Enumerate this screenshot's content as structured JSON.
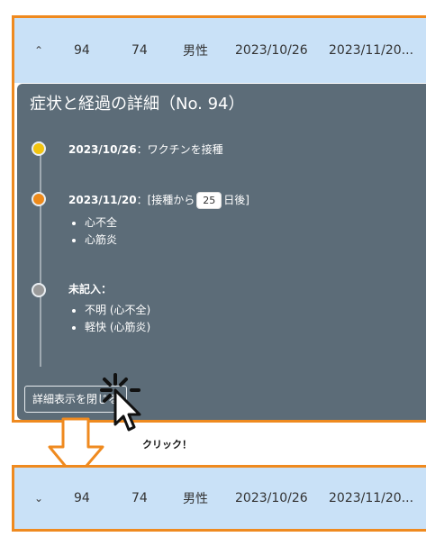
{
  "colors": {
    "frame": "#ef8a1f",
    "row_bg": "#c9e1f7",
    "panel_bg": "#5c6c78",
    "dot_first": "#f2c40f",
    "dot_second": "#ee8a1a",
    "dot_unknown": "#9a9a9a"
  },
  "row": {
    "id": "94",
    "age": "74",
    "sex": "男性",
    "date1": "2023/10/26",
    "date2": "2023/11/20..."
  },
  "top_row": {
    "chevron_icon": "chevron-up-icon",
    "chevron": "⌃"
  },
  "bottom_row": {
    "chevron_icon": "chevron-down-icon",
    "chevron": "⌄"
  },
  "detail": {
    "title": "症状と経過の詳細（No. 94）",
    "entries": [
      {
        "date": "2023/10/26",
        "sep": "：",
        "text": "ワクチンを接種"
      },
      {
        "date": "2023/11/20",
        "sep": "：",
        "prefix": "[接種から",
        "days": "25",
        "suffix": "日後]",
        "items": [
          "心不全",
          "心筋炎"
        ]
      },
      {
        "date": "未記入",
        "sep": "：",
        "items": [
          "不明 (心不全)",
          "軽快 (心筋炎)"
        ]
      }
    ],
    "close_button": "詳細表示を閉じる"
  },
  "annotation": {
    "click_label": "クリック！"
  }
}
